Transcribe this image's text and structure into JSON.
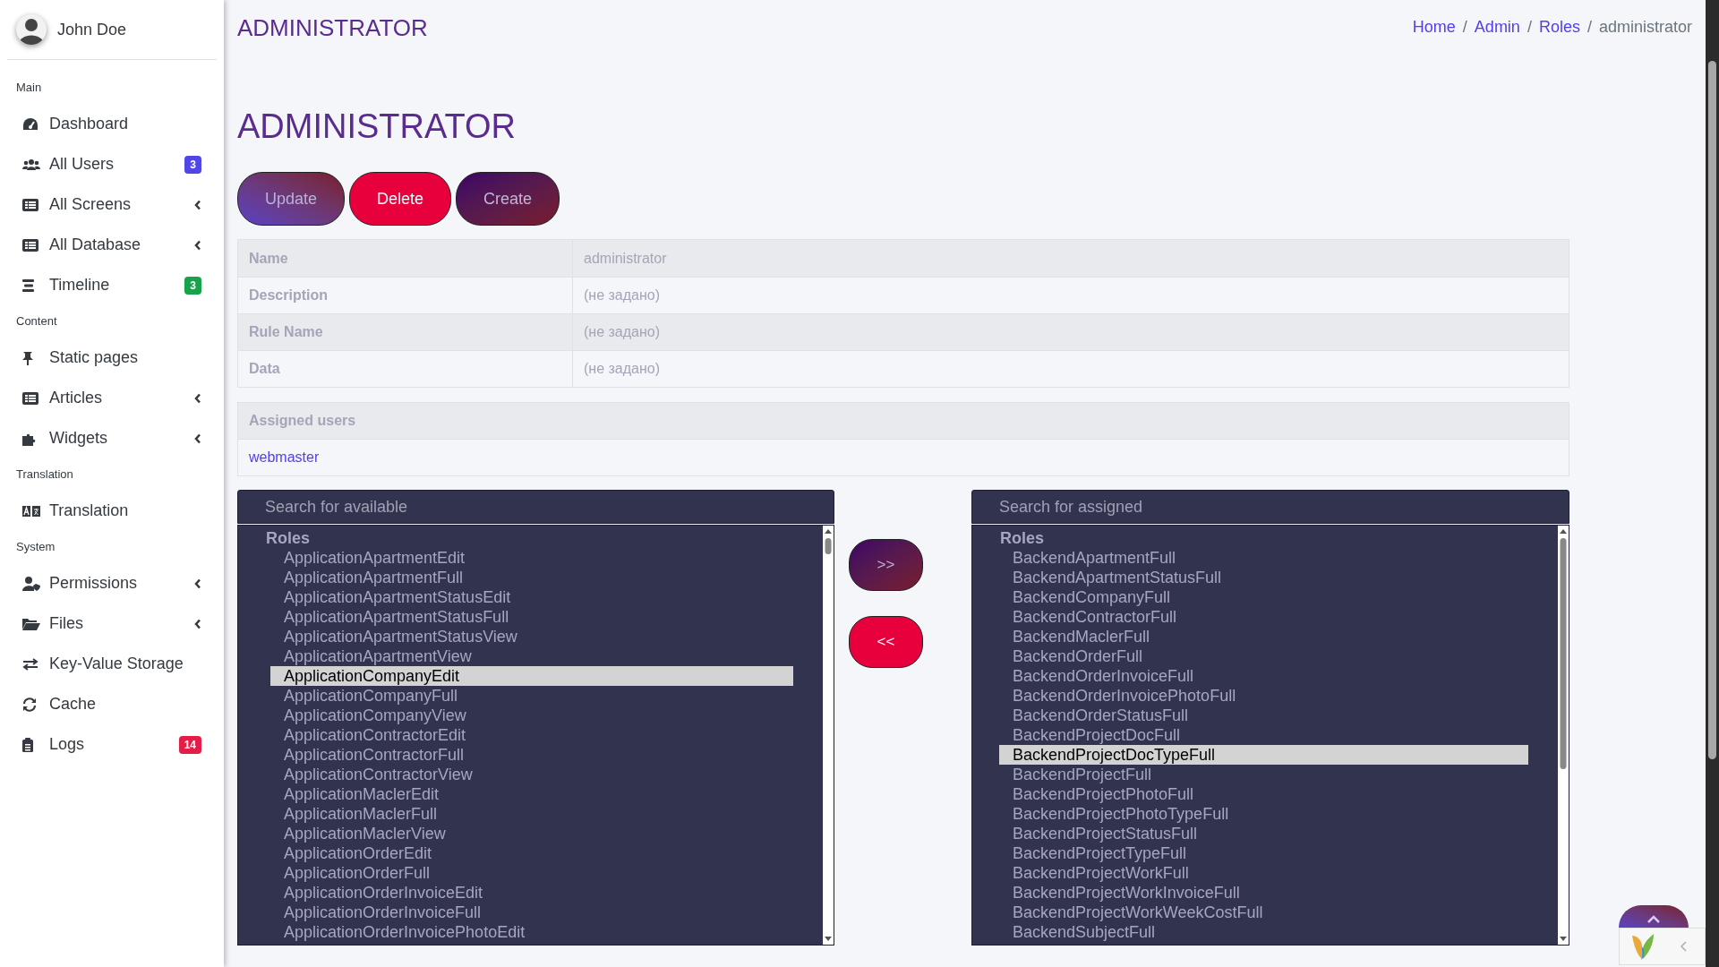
{
  "sidebar": {
    "user": {
      "name": "John Doe"
    },
    "sections": [
      {
        "heading": "Main",
        "items": [
          {
            "label": "Dashboard",
            "kind": "link"
          },
          {
            "label": "All Users",
            "kind": "link",
            "badge": "3",
            "color": "#4f46e5"
          },
          {
            "label": "All Screens",
            "kind": "submenu"
          },
          {
            "label": "All Database",
            "kind": "submenu"
          },
          {
            "label": "Timeline",
            "kind": "link",
            "badge": "3",
            "color": "#16a34a"
          }
        ]
      },
      {
        "heading": "Content",
        "items": [
          {
            "label": "Static pages",
            "kind": "link"
          },
          {
            "label": "Articles",
            "kind": "submenu"
          },
          {
            "label": "Widgets",
            "kind": "submenu"
          }
        ]
      },
      {
        "heading": "Translation",
        "items": [
          {
            "label": "Translation",
            "kind": "link"
          }
        ]
      },
      {
        "heading": "System",
        "items": [
          {
            "label": "Permissions",
            "kind": "submenu"
          },
          {
            "label": "Files",
            "kind": "submenu"
          },
          {
            "label": "Key-Value Storage",
            "kind": "link"
          },
          {
            "label": "Cache",
            "kind": "link"
          },
          {
            "label": "Logs",
            "kind": "link",
            "badge": "14",
            "color": "#e11d48"
          }
        ]
      }
    ]
  },
  "header": {
    "title": "ADMINISTRATOR",
    "breadcrumb": [
      {
        "label": "Home",
        "kind": "link"
      },
      {
        "label": "/",
        "kind": "separator"
      },
      {
        "label": "Admin",
        "kind": "link"
      },
      {
        "label": "/",
        "kind": "separator"
      },
      {
        "label": "Roles",
        "kind": "link"
      },
      {
        "label": "/",
        "kind": "separator"
      },
      {
        "label": "administrator",
        "kind": "current"
      }
    ]
  },
  "page_title": "ADMINISTRATOR",
  "actions": [
    {
      "label": "Update",
      "kind": "primary"
    },
    {
      "label": "Delete",
      "kind": "danger"
    },
    {
      "label": "Create",
      "kind": "secondary"
    }
  ],
  "details": [
    {
      "label": "Name",
      "value": "administrator"
    },
    {
      "label": "Description",
      "value": "(не задано)"
    },
    {
      "label": "Rule Name",
      "value": "(не задано)"
    },
    {
      "label": "Data",
      "value": "(не задано)"
    }
  ],
  "assigned_users": {
    "heading": "Assigned users",
    "users": [
      "webmaster"
    ]
  },
  "available": {
    "placeholder": "Search for available",
    "group": "Roles",
    "items": [
      {
        "label": "ApplicationApartmentEdit",
        "selected": false
      },
      {
        "label": "ApplicationApartmentFull",
        "selected": false
      },
      {
        "label": "ApplicationApartmentStatusEdit",
        "selected": false
      },
      {
        "label": "ApplicationApartmentStatusFull",
        "selected": false
      },
      {
        "label": "ApplicationApartmentStatusView",
        "selected": false
      },
      {
        "label": "ApplicationApartmentView",
        "selected": false
      },
      {
        "label": "ApplicationCompanyEdit",
        "selected": true
      },
      {
        "label": "ApplicationCompanyFull",
        "selected": false
      },
      {
        "label": "ApplicationCompanyView",
        "selected": false
      },
      {
        "label": "ApplicationContractorEdit",
        "selected": false
      },
      {
        "label": "ApplicationContractorFull",
        "selected": false
      },
      {
        "label": "ApplicationContractorView",
        "selected": false
      },
      {
        "label": "ApplicationMaclerEdit",
        "selected": false
      },
      {
        "label": "ApplicationMaclerFull",
        "selected": false
      },
      {
        "label": "ApplicationMaclerView",
        "selected": false
      },
      {
        "label": "ApplicationOrderEdit",
        "selected": false
      },
      {
        "label": "ApplicationOrderFull",
        "selected": false
      },
      {
        "label": "ApplicationOrderInvoiceEdit",
        "selected": false
      },
      {
        "label": "ApplicationOrderInvoiceFull",
        "selected": false
      },
      {
        "label": "ApplicationOrderInvoicePhotoEdit",
        "selected": false
      }
    ]
  },
  "transfer": [
    {
      "label": ">>",
      "kind": "secondary"
    },
    {
      "label": "<<",
      "kind": "danger"
    }
  ],
  "assigned": {
    "placeholder": "Search for assigned",
    "group": "Roles",
    "items": [
      {
        "label": "BackendApartmentFull",
        "selected": false
      },
      {
        "label": "BackendApartmentStatusFull",
        "selected": false
      },
      {
        "label": "BackendCompanyFull",
        "selected": false
      },
      {
        "label": "BackendContractorFull",
        "selected": false
      },
      {
        "label": "BackendMaclerFull",
        "selected": false
      },
      {
        "label": "BackendOrderFull",
        "selected": false
      },
      {
        "label": "BackendOrderInvoiceFull",
        "selected": false
      },
      {
        "label": "BackendOrderInvoicePhotoFull",
        "selected": false
      },
      {
        "label": "BackendOrderStatusFull",
        "selected": false
      },
      {
        "label": "BackendProjectDocFull",
        "selected": false
      },
      {
        "label": "BackendProjectDocTypeFull",
        "selected": true
      },
      {
        "label": "BackendProjectFull",
        "selected": false
      },
      {
        "label": "BackendProjectPhotoFull",
        "selected": false
      },
      {
        "label": "BackendProjectPhotoTypeFull",
        "selected": false
      },
      {
        "label": "BackendProjectStatusFull",
        "selected": false
      },
      {
        "label": "BackendProjectTypeFull",
        "selected": false
      },
      {
        "label": "BackendProjectWorkFull",
        "selected": false
      },
      {
        "label": "BackendProjectWorkInvoiceFull",
        "selected": false
      },
      {
        "label": "BackendProjectWorkWeekCostFull",
        "selected": false
      },
      {
        "label": "BackendSubjectFull",
        "selected": false
      }
    ]
  }
}
